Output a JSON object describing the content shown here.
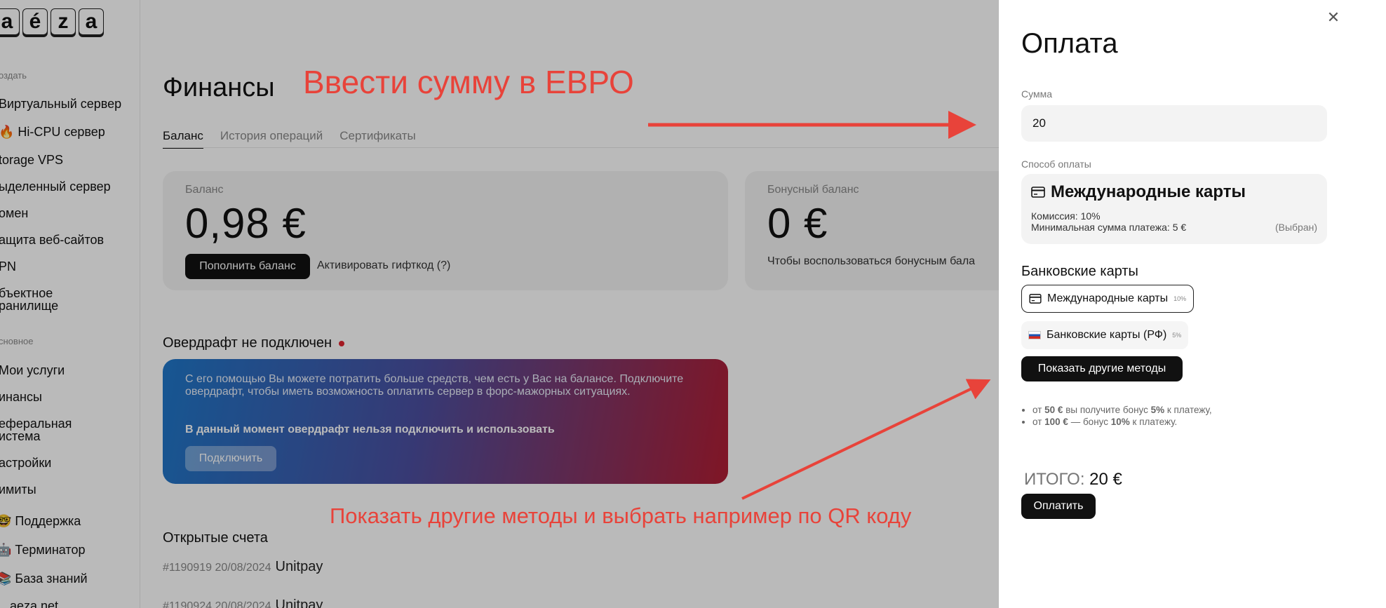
{
  "sidebar": {
    "logo_letters": [
      "a",
      "é",
      "z",
      "a"
    ],
    "group_create": "оздать",
    "items_create": [
      "Виртуальный сервер",
      "🔥 Hi-CPU сервер",
      "torage VPS",
      "ыделенный сервер",
      "омен",
      "ащита веб-сайтов",
      "PN",
      "бъектное",
      "ранилище"
    ],
    "group_main": "сновное",
    "items_main": [
      "Мои услуги",
      "инансы",
      "еферальная",
      "истема",
      "астройки",
      "имиты",
      "🤓 Поддержка",
      "🤖 Терминатор",
      "📚 База знаний",
      "aeza.net"
    ]
  },
  "main": {
    "title": "Финансы",
    "tabs": [
      "Баланс",
      "История операций",
      "Сертификаты"
    ],
    "balance_card": {
      "label": "Баланс",
      "amount": "0,98 €",
      "topup_button": "Пополнить баланс",
      "gift_link": "Активировать гифткод (?)"
    },
    "bonus_card": {
      "label": "Бонусный баланс",
      "amount": "0 €",
      "hint": "Чтобы воспользоваться бонусным бала"
    },
    "overdraft": {
      "title": "Овердрафт не подключен",
      "text": "С его помощью Вы можете потратить больше средств, чем есть у Вас на балансе. Подключите овердрафт, чтобы иметь возможность оплатить сервер в форс-мажорных ситуациях.",
      "bold": "В данный момент овердрафт нельзя подключить и использовать",
      "button": "Подключить"
    },
    "open_invoices": {
      "title": "Открытые счета",
      "items": [
        {
          "id": "#1190919 20/08/2024",
          "provider": "Unitpay"
        },
        {
          "id": "#1190924 20/08/2024",
          "provider": "Unitpay"
        }
      ]
    }
  },
  "annotations": {
    "top": "Ввести сумму в ЕВРО",
    "bottom": "Показать другие методы и выбрать например по QR коду",
    "color": "#e8433a"
  },
  "payment_panel": {
    "title": "Оплата",
    "close_icon": "close-icon",
    "amount_label": "Сумма",
    "amount_value": "20",
    "method_label": "Способ оплаты",
    "selected_method": {
      "name": "Международные карты",
      "commission": "Комиссия: 10%",
      "min_sum": "Минимальная сумма платежа: 5 €",
      "chosen": "(Выбран)"
    },
    "bank_cards_title": "Банковские карты",
    "methods": [
      {
        "name": "Международные карты",
        "fee": "10%",
        "icon": "card-icon"
      },
      {
        "name": "Банковские карты (РФ)",
        "fee": "5%",
        "icon": "russia-flag-icon"
      }
    ],
    "show_more_button": "Показать другие методы",
    "bonus_lines": [
      {
        "pre": "от ",
        "amount": "50 €",
        "mid": " вы получите бонус ",
        "pct": "5%",
        "post": " к платежу,"
      },
      {
        "pre": "от ",
        "amount": "100 €",
        "mid": " — бонус ",
        "pct": "10%",
        "post": " к платежу."
      }
    ],
    "total_label": "ИТОГО:",
    "total_value": "20 €",
    "pay_button": "Оплатить"
  }
}
